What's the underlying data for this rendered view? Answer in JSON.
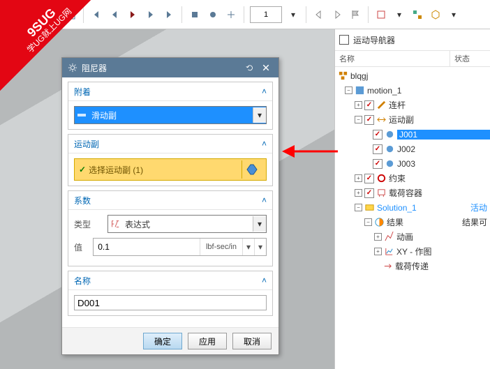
{
  "ribbon": {
    "line1": "9SUG",
    "line2": "学UG就上UG网"
  },
  "toolbar": {
    "frame": "1"
  },
  "nav": {
    "title": "运动导航器",
    "col_name": "名称",
    "col_status": "状态",
    "root": "blqgj",
    "motion": "motion_1",
    "links": "连杆",
    "joints": "运动副",
    "j001": "J001",
    "j002": "J002",
    "j003": "J003",
    "constraints": "约束",
    "loads": "载荷容器",
    "solution": "Solution_1",
    "solution_status": "活动",
    "results": "结果",
    "results_status": "结果可",
    "anim": "动画",
    "xy": "XY - 作图",
    "load_transfer": "载荷传递"
  },
  "dlg": {
    "title": "阻尼器",
    "sec_attach": "附着",
    "attach_value": "滑动副",
    "sec_joint": "运动副",
    "pick_label": "选择运动副 (1)",
    "sec_coeff": "系数",
    "label_type": "类型",
    "type_value": "表达式",
    "label_value": "值",
    "value": "0.1",
    "unit": "lbf-sec/in",
    "sec_name": "名称",
    "name_value": "D001",
    "btn_ok": "确定",
    "btn_apply": "应用",
    "btn_cancel": "取消"
  }
}
